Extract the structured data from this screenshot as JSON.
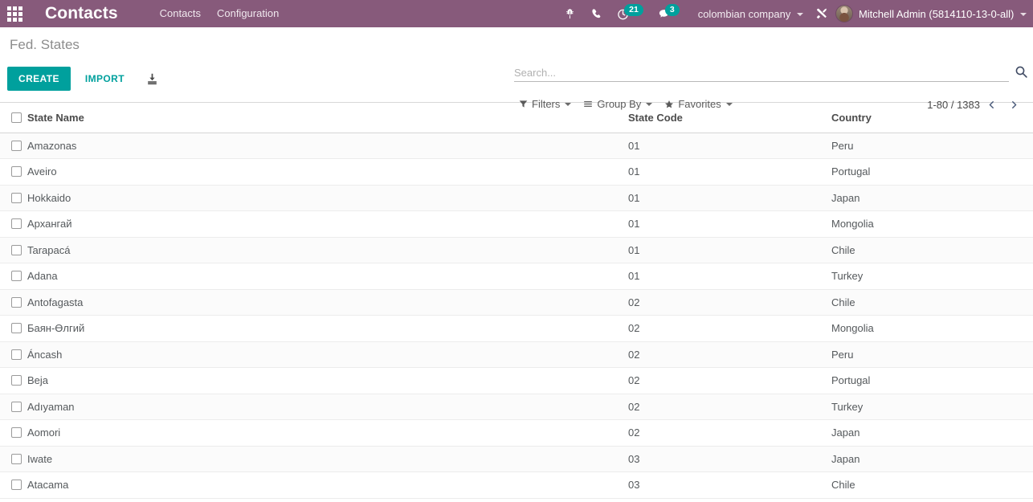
{
  "navbar": {
    "apps_icon": "apps-grid-icon",
    "brand": "Contacts",
    "menu": [
      {
        "label": "Contacts"
      },
      {
        "label": "Configuration"
      }
    ],
    "systray": [
      {
        "name": "bug-icon",
        "badge": null
      },
      {
        "name": "phone-icon",
        "badge": null
      },
      {
        "name": "activity-clock-icon",
        "badge": "21"
      },
      {
        "name": "messages-icon",
        "badge": "3"
      }
    ],
    "company": "colombian company",
    "settings_icon": "tools-icon",
    "user": "Mitchell Admin (5814110-13-0-all)"
  },
  "control_panel": {
    "breadcrumb": "Fed. States",
    "create_label": "CREATE",
    "import_label": "IMPORT",
    "export_icon": "download-export-icon",
    "search": {
      "placeholder": "Search...",
      "value": "",
      "icon": "search-magnifier-icon"
    },
    "filters": [
      {
        "name": "filters",
        "label": "Filters",
        "icon": "funnel-icon"
      },
      {
        "name": "group-by",
        "label": "Group By",
        "icon": "bars-icon"
      },
      {
        "name": "favorites",
        "label": "Favorites",
        "icon": "star-icon"
      }
    ],
    "pager": {
      "value": "1-80 / 1383",
      "prev_icon": "chevron-left-icon",
      "next_icon": "chevron-right-icon"
    }
  },
  "table": {
    "columns": [
      "State Name",
      "State Code",
      "Country"
    ],
    "rows": [
      {
        "name": "Amazonas",
        "code": "01",
        "country": "Peru"
      },
      {
        "name": "Aveiro",
        "code": "01",
        "country": "Portugal"
      },
      {
        "name": "Hokkaido",
        "code": "01",
        "country": "Japan"
      },
      {
        "name": "Архангай",
        "code": "01",
        "country": "Mongolia"
      },
      {
        "name": "Tarapacá",
        "code": "01",
        "country": "Chile"
      },
      {
        "name": "Adana",
        "code": "01",
        "country": "Turkey"
      },
      {
        "name": "Antofagasta",
        "code": "02",
        "country": "Chile"
      },
      {
        "name": "Баян-Өлгий",
        "code": "02",
        "country": "Mongolia"
      },
      {
        "name": "Áncash",
        "code": "02",
        "country": "Peru"
      },
      {
        "name": "Beja",
        "code": "02",
        "country": "Portugal"
      },
      {
        "name": "Adıyaman",
        "code": "02",
        "country": "Turkey"
      },
      {
        "name": "Aomori",
        "code": "02",
        "country": "Japan"
      },
      {
        "name": "Iwate",
        "code": "03",
        "country": "Japan"
      },
      {
        "name": "Atacama",
        "code": "03",
        "country": "Chile"
      }
    ]
  },
  "colors": {
    "brand_purple": "#875A7B",
    "accent_teal": "#00A09D",
    "text_muted": "#8c8c8c",
    "row_border": "#ececec"
  }
}
